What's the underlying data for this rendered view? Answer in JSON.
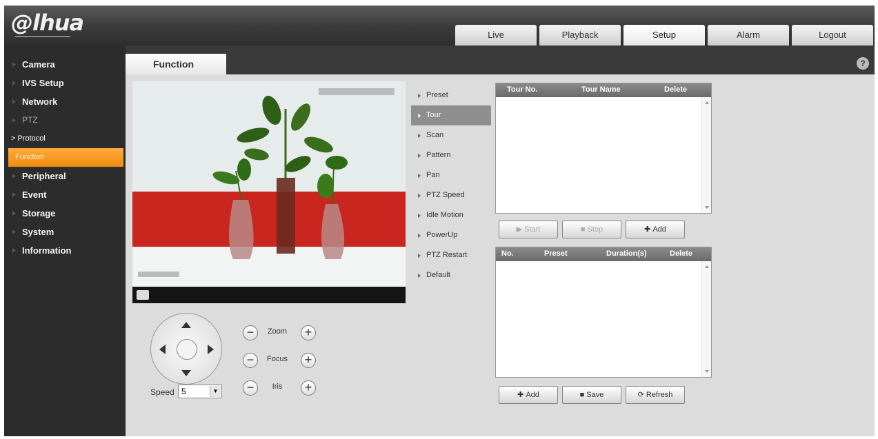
{
  "brand": {
    "logo_text": "@lhua"
  },
  "nav": {
    "tabs": [
      "Live",
      "Playback",
      "Setup",
      "Alarm",
      "Logout"
    ],
    "active": "Setup"
  },
  "sidebar": {
    "items": [
      "Camera",
      "IVS Setup",
      "Network",
      "PTZ",
      "Peripheral",
      "Event",
      "Storage",
      "System",
      "Information"
    ],
    "ptz_sub": {
      "protocol": "> Protocol",
      "function": "Function"
    }
  },
  "page": {
    "tab_title": "Function",
    "help": "?"
  },
  "ptz": {
    "speed_label": "Speed",
    "speed_value": "5",
    "zoom_label": "Zoom",
    "focus_label": "Focus",
    "iris_label": "Iris",
    "minus": "−",
    "plus": "+"
  },
  "function_menu": {
    "items": [
      "Preset",
      "Tour",
      "Scan",
      "Pattern",
      "Pan",
      "PTZ Speed",
      "Idle Motion",
      "PowerUp",
      "PTZ Restart",
      "Default"
    ],
    "active": "Tour"
  },
  "tour_table": {
    "headers": [
      "Tour No.",
      "Tour Name",
      "Delete"
    ],
    "buttons": {
      "start": "Start",
      "stop": "Stop",
      "add": "Add"
    }
  },
  "preset_table": {
    "headers": [
      "No.",
      "Preset",
      "Duration(s)",
      "Delete"
    ],
    "buttons": {
      "add": "Add",
      "save": "Save",
      "refresh": "Refresh"
    }
  },
  "colors": {
    "accent": "#f08a10",
    "header_bg": "#3a3a3a",
    "content_bg": "#dcdcdc"
  }
}
